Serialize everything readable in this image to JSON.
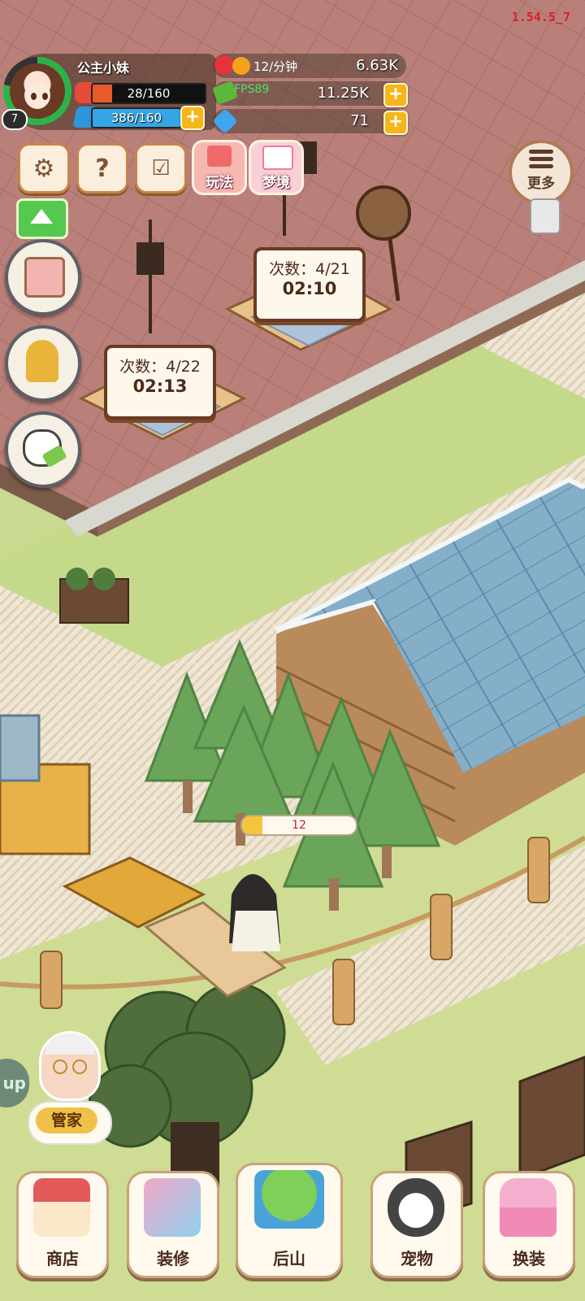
{
  "version": "1.54.5_7",
  "player": {
    "name": "公主小妹",
    "level": "7",
    "stamina": "28/160",
    "exp": "386/160"
  },
  "resources": {
    "rate": "12/分钟",
    "hearts": "6.63K",
    "fps": "FPS89",
    "cash": "11.25K",
    "gems": "71"
  },
  "toolbar": {
    "play_label": "玩法",
    "dream_label": "梦境",
    "more_label": "更多"
  },
  "stations": [
    {
      "count": "次数：4/21",
      "time": "02:10"
    },
    {
      "count": "次数：4/22",
      "time": "02:13"
    }
  ],
  "harvest": {
    "value": "12",
    "progress": 0.18
  },
  "butler": {
    "label": "管家"
  },
  "side_tab": "up",
  "nav": {
    "shop": "商店",
    "decor": "装修",
    "mountain": "后山",
    "pet": "宠物",
    "dress": "换装"
  },
  "colors": {
    "grass": "#c9d98f",
    "floor": "#b98079",
    "roof": "#7fa6c0",
    "accent": "#f5b51b"
  }
}
